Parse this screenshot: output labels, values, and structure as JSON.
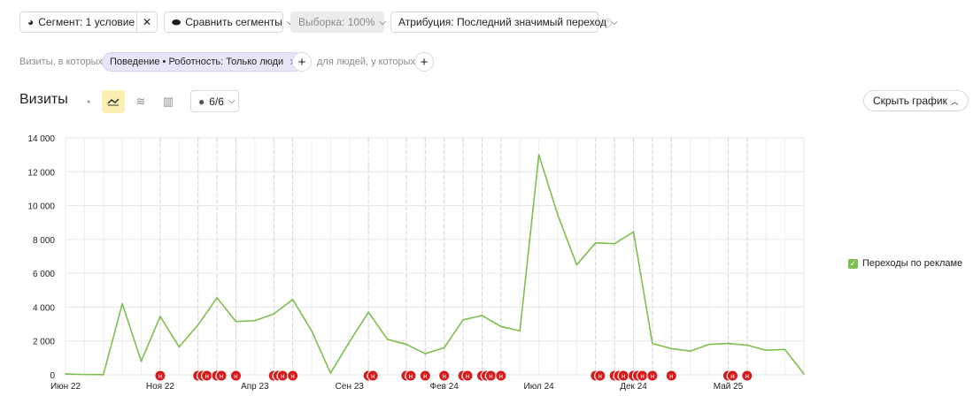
{
  "toolbar": {
    "segment_label": "Сегмент: 1 условие",
    "compare_label": "Сравнить сегменты",
    "sample_label": "Выборка: 100%",
    "attribution_label": "Атрибуция: Последний значимый переход",
    "help_glyph": "?"
  },
  "filter": {
    "visits_where": "Визиты, в которых",
    "chip_label": "Поведение • Роботность: Только люди",
    "people_where": "для людей, у которых"
  },
  "header": {
    "title": "Визиты",
    "annotations_label": "6/6",
    "hide_chart_label": "Скрыть график"
  },
  "colors": {
    "line": "#7dbf4e",
    "marker": "#d71a1a",
    "grid": "#e6e6e6",
    "active_view": "#fcefb3"
  },
  "icons": {
    "segment": "pie-icon",
    "compare": "drops-icon",
    "clear": "close-icon",
    "view_pie": "pie-chart-icon",
    "view_line": "line-chart-icon",
    "view_area": "stacked-area-icon",
    "view_bar": "bar-chart-icon",
    "comment": "comment-icon"
  },
  "legend": {
    "series_label": "Переходы по рекламе"
  },
  "chart_data": {
    "type": "line",
    "x": [
      "2022-06",
      "2022-07",
      "2022-08",
      "2022-09",
      "2022-10",
      "2022-11",
      "2022-12",
      "2023-01",
      "2023-02",
      "2023-03",
      "2023-04",
      "2023-05",
      "2023-06",
      "2023-07",
      "2023-08",
      "2023-09",
      "2023-10",
      "2023-11",
      "2023-12",
      "2024-01",
      "2024-02",
      "2024-03",
      "2024-04",
      "2024-05",
      "2024-06",
      "2024-07",
      "2024-08",
      "2024-09",
      "2024-10",
      "2024-11",
      "2024-12",
      "2025-01",
      "2025-02",
      "2025-03",
      "2025-04",
      "2025-05",
      "2025-06",
      "2025-07",
      "2025-08",
      "2025-09"
    ],
    "series": [
      {
        "name": "Переходы по рекламе",
        "values": [
          50,
          20,
          10,
          4200,
          800,
          3450,
          1650,
          2950,
          4550,
          3150,
          3200,
          3600,
          4450,
          2600,
          100,
          1950,
          3700,
          2100,
          1800,
          1250,
          1600,
          3250,
          3500,
          2850,
          2600,
          13000,
          9450,
          6500,
          7800,
          7750,
          8450,
          1850,
          1550,
          1400,
          1800,
          1850,
          1750,
          1450,
          1500,
          50
        ]
      }
    ],
    "x_tick_labels": [
      "Июн 22",
      "Ноя 22",
      "Апр 23",
      "Сен 23",
      "Фев 24",
      "Июл 24",
      "Дек 24",
      "Май 25"
    ],
    "x_tick_values": [
      "2022-06",
      "2022-11",
      "2023-04",
      "2023-09",
      "2024-02",
      "2024-07",
      "2024-12",
      "2025-05"
    ],
    "y_tick_labels": [
      "0",
      "2 000",
      "4 000",
      "6 000",
      "8 000",
      "10 000",
      "12 000",
      "14 000"
    ],
    "ylim": [
      0,
      14000
    ],
    "grid": true,
    "legend_position": "right",
    "annotation_marker_label": "н",
    "annotation_markers": [
      "2022-11",
      "2023-01",
      "2023-01",
      "2023-01",
      "2023-02",
      "2023-02",
      "2023-03",
      "2023-05",
      "2023-05",
      "2023-05",
      "2023-06",
      "2023-10",
      "2023-10",
      "2023-12",
      "2023-12",
      "2024-01",
      "2024-02",
      "2024-03",
      "2024-03",
      "2024-04",
      "2024-04",
      "2024-04",
      "2024-05",
      "2024-10",
      "2024-10",
      "2024-11",
      "2024-11",
      "2024-11",
      "2024-12",
      "2024-12",
      "2024-12",
      "2025-01",
      "2025-02",
      "2025-05",
      "2025-05",
      "2025-06"
    ]
  }
}
